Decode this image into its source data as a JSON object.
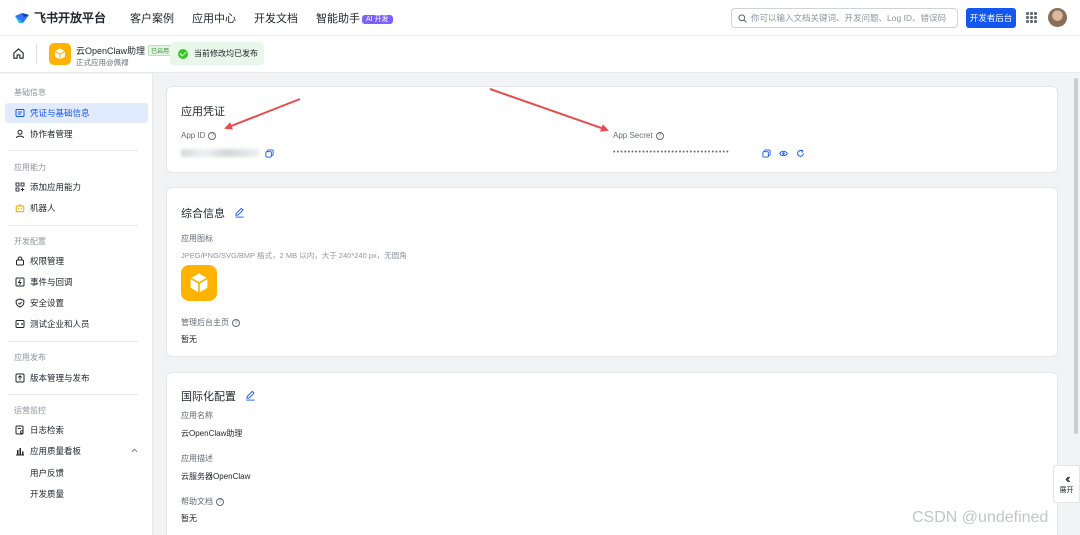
{
  "topnav": {
    "brand": "飞书开放平台",
    "links": [
      "客户案例",
      "应用中心",
      "开发文档",
      "智能助手"
    ],
    "ai_badge": "AI 开发",
    "search_placeholder": "你可以输入文档关键词、开发问题、Log ID、错误码",
    "dev_console": "开发者后台"
  },
  "subheader": {
    "app_name": "云OpenClaw助理",
    "app_tag": "已启用",
    "app_sub": "正式应用@佩禄",
    "publish_status": "当前修改均已发布"
  },
  "sidebar": {
    "sections": [
      {
        "title": "基础信息",
        "items": [
          "凭证与基础信息",
          "协作者管理"
        ]
      },
      {
        "title": "应用能力",
        "items": [
          "添加应用能力",
          "机器人"
        ]
      },
      {
        "title": "开发配置",
        "items": [
          "权限管理",
          "事件与回调",
          "安全设置",
          "测试企业和人员"
        ]
      },
      {
        "title": "应用发布",
        "items": [
          "版本管理与发布"
        ]
      },
      {
        "title": "运营监控",
        "items": [
          "日志检索",
          "应用质量看板",
          "用户反馈",
          "开发质量"
        ]
      }
    ]
  },
  "credentials": {
    "title": "应用凭证",
    "app_id_label": "App ID",
    "app_secret_label": "App Secret",
    "secret_mask": "••••••••••••••••••••••••••••••••"
  },
  "general": {
    "title": "综合信息",
    "icon_label": "应用图标",
    "icon_hint": "JPEG/PNG/SVG/BMP 格式，2 MB 以内，大于 240*240 px，无圆角",
    "admin_home_label": "管理后台主页",
    "admin_home_value": "暂无"
  },
  "i18n": {
    "title": "国际化配置",
    "name_label": "应用名称",
    "name_value": "云OpenClaw助理",
    "desc_label": "应用描述",
    "desc_value": "云服务器OpenClaw",
    "help_label": "帮助文档",
    "help_value": "暂无"
  },
  "expand": "展开",
  "watermark": "CSDN @undefined",
  "colors": {
    "primary": "#1456f0",
    "app_icon": "#ffb200",
    "success": "#34c724",
    "arrow": "#e84c4c"
  }
}
